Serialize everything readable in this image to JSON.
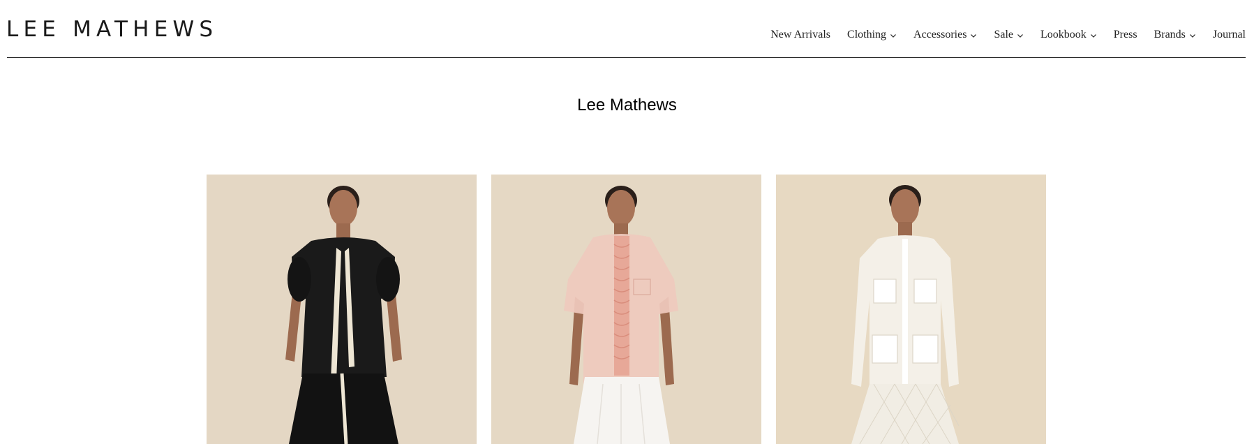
{
  "header": {
    "logo_text": "LEE MATHEWS",
    "nav": [
      {
        "label": "New Arrivals",
        "dropdown": false
      },
      {
        "label": "Clothing",
        "dropdown": true
      },
      {
        "label": "Accessories",
        "dropdown": true
      },
      {
        "label": "Sale",
        "dropdown": true
      },
      {
        "label": "Lookbook",
        "dropdown": true
      },
      {
        "label": "Press",
        "dropdown": false
      },
      {
        "label": "Brands",
        "dropdown": true
      },
      {
        "label": "Journal",
        "dropdown": false
      }
    ]
  },
  "main": {
    "title": "Lee Mathews",
    "products": [
      {
        "image": "model-black-smock-top-photo",
        "background": "#e8dccc",
        "garment": "#1a1a1a"
      },
      {
        "image": "model-pink-ruffle-shirt-photo",
        "background": "#e9decb",
        "garment": "#efc9bd"
      },
      {
        "image": "model-white-cargo-shirt-dress-photo",
        "background": "#ebdfca",
        "garment": "#f4f1ea"
      }
    ]
  },
  "colors": {
    "text": "#111111",
    "rule": "#222222",
    "background": "#ffffff"
  }
}
